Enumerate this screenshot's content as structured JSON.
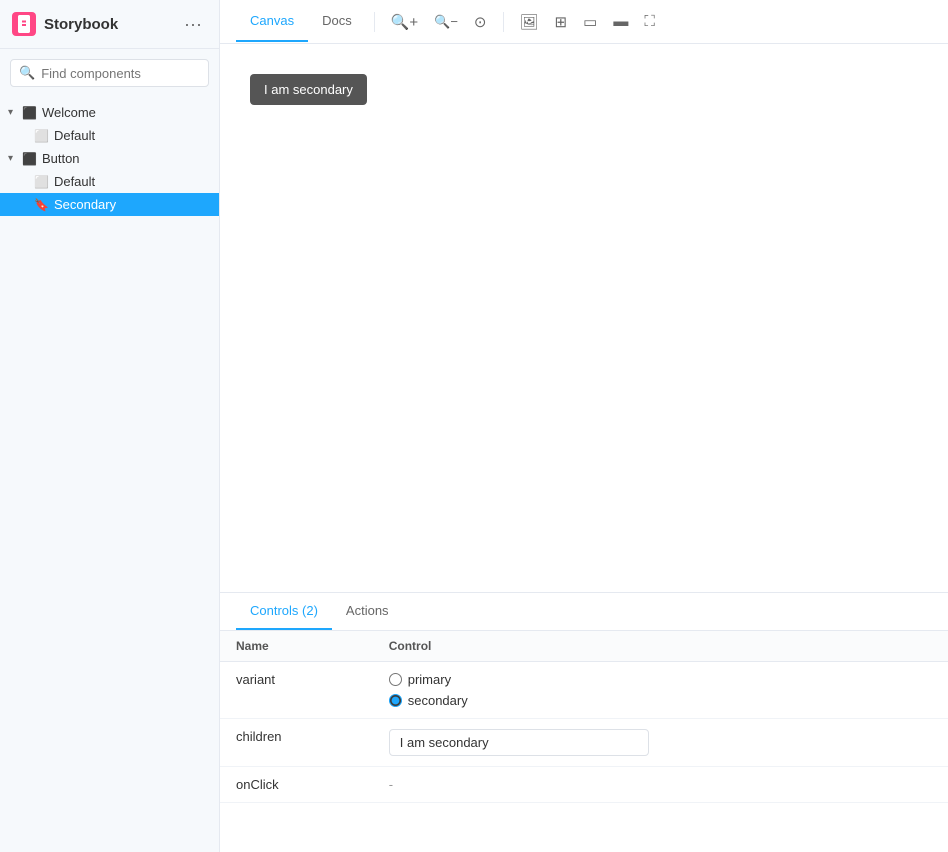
{
  "app": {
    "title": "Storybook"
  },
  "search": {
    "placeholder": "Find components",
    "shortcut": "/"
  },
  "tree": {
    "items": [
      {
        "id": "welcome",
        "label": "Welcome",
        "type": "group",
        "indent": 0,
        "arrow": "▾",
        "icon": "component"
      },
      {
        "id": "welcome-default",
        "label": "Default",
        "type": "story",
        "indent": 1,
        "icon": "story"
      },
      {
        "id": "button",
        "label": "Button",
        "type": "group",
        "indent": 0,
        "arrow": "▾",
        "icon": "component"
      },
      {
        "id": "button-default",
        "label": "Default",
        "type": "story",
        "indent": 1,
        "icon": "story"
      },
      {
        "id": "button-secondary",
        "label": "Secondary",
        "type": "story",
        "indent": 1,
        "icon": "bookmark",
        "active": true
      }
    ]
  },
  "toolbar": {
    "tabs": [
      {
        "id": "canvas",
        "label": "Canvas",
        "active": true
      },
      {
        "id": "docs",
        "label": "Docs",
        "active": false
      }
    ],
    "tools": [
      "zoom-in",
      "zoom-out",
      "zoom-reset",
      "image",
      "grid",
      "layout",
      "layout-alt",
      "fullscreen"
    ]
  },
  "canvas": {
    "preview_button_label": "I am secondary"
  },
  "bottom_panel": {
    "tabs": [
      {
        "id": "controls",
        "label": "Controls (2)",
        "active": true
      },
      {
        "id": "actions",
        "label": "Actions",
        "active": false
      }
    ],
    "table": {
      "headers": [
        "Name",
        "Control"
      ],
      "rows": [
        {
          "name": "variant",
          "control_type": "radio",
          "options": [
            "primary",
            "secondary"
          ],
          "selected": "secondary"
        },
        {
          "name": "children",
          "control_type": "text",
          "value": "I am secondary"
        },
        {
          "name": "onClick",
          "control_type": "dash",
          "value": "-"
        }
      ]
    }
  }
}
